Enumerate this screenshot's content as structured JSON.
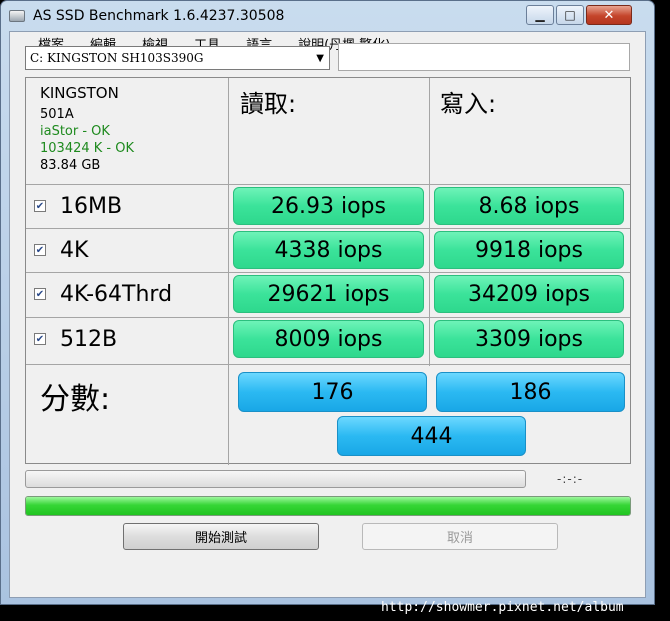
{
  "window": {
    "title": "AS SSD Benchmark 1.6.4237.30508"
  },
  "menu": [
    "檔案",
    "編輯",
    "檢視",
    "工具",
    "語言",
    "說明(丹楓 繁化)"
  ],
  "drive_select": {
    "value": "C: KINGSTON SH103S390G"
  },
  "info": {
    "name": "KINGSTON",
    "firmware": "501A",
    "driver": "iaStor - OK",
    "alignment": "103424 K - OK",
    "size": "83.84 GB"
  },
  "columns": {
    "read": "讀取:",
    "write": "寫入:"
  },
  "rows": [
    {
      "label": "16MB",
      "read": "26.93 iops",
      "write": "8.68 iops",
      "checked": true
    },
    {
      "label": "4K",
      "read": "4338 iops",
      "write": "9918 iops",
      "checked": true
    },
    {
      "label": "4K-64Thrd",
      "read": "29621 iops",
      "write": "34209 iops",
      "checked": true
    },
    {
      "label": "512B",
      "read": "8009 iops",
      "write": "3309 iops",
      "checked": true
    }
  ],
  "score": {
    "label": "分數:",
    "read": "176",
    "write": "186",
    "total": "444"
  },
  "progress": {
    "time": "-:-:-",
    "overall_fraction": 1.0,
    "task_fraction": 0.0
  },
  "buttons": {
    "start": "開始測試",
    "cancel": "取消"
  },
  "watermark": "http://showmer.pixnet.net/album",
  "colors": {
    "result_green": "#3be39a",
    "score_blue": "#2bb9f2",
    "progress_green": "#36d636"
  }
}
